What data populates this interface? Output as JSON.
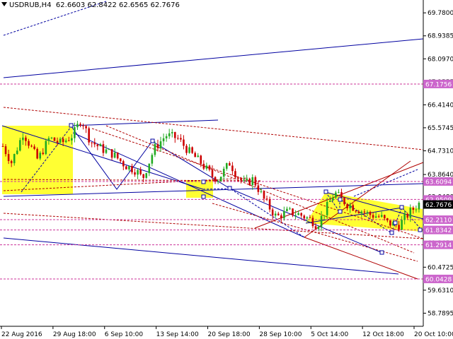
{
  "header": {
    "symbol": "USDRUB,H4",
    "ohlc": "62.6603 62.8422 62.6565 62.7676"
  },
  "colors": {
    "background": "#ffffff",
    "bull_candle": "#22aa22",
    "bear_candle": "#cc0000",
    "blue_lines": "#0000a0",
    "red_lines": "#b00000",
    "zones": "#ffff33",
    "label_bg": "#cc66cc",
    "current_bg": "#000000"
  },
  "chart_data": {
    "type": "candlestick",
    "title": "",
    "xlabel": "",
    "ylabel": "",
    "ylim": [
      58.31,
      70.25
    ],
    "y_ticks": [
      "69.7800",
      "68.9385",
      "68.0970",
      "67.2555",
      "66.4140",
      "65.5745",
      "64.7310",
      "63.8640",
      "63.0480",
      "62.2065",
      "61.3650",
      "60.4725",
      "59.6310",
      "58.7895"
    ],
    "x_ticks": [
      "22 Aug 2016",
      "29 Aug 18:00",
      "6 Sep 10:00",
      "13 Sep 14:00",
      "20 Sep 18:00",
      "28 Sep 10:00",
      "5 Oct 14:00",
      "12 Oct 18:00",
      "20 Oct 10:00"
    ],
    "price_labels": [
      {
        "text": "67.1756",
        "value": 67.1756,
        "kind": "level"
      },
      {
        "text": "63.6094",
        "value": 63.6094,
        "kind": "level"
      },
      {
        "text": "62.9509",
        "value": 62.9509,
        "kind": "level"
      },
      {
        "text": "62.7676",
        "value": 62.7676,
        "kind": "current"
      },
      {
        "text": "62.2110",
        "value": 62.211,
        "kind": "level"
      },
      {
        "text": "61.8342",
        "value": 61.8342,
        "kind": "level"
      },
      {
        "text": "61.2914",
        "value": 61.2914,
        "kind": "level"
      },
      {
        "text": "60.0428",
        "value": 60.0428,
        "kind": "level"
      }
    ],
    "candle_path": [
      [
        0,
        64.9
      ],
      [
        3,
        64.3
      ],
      [
        7,
        65.4
      ],
      [
        12,
        64.4
      ],
      [
        16,
        65.2
      ],
      [
        20,
        65.0
      ],
      [
        24,
        65.3
      ],
      [
        27,
        65.9
      ],
      [
        30,
        65.1
      ],
      [
        34,
        64.8
      ],
      [
        38,
        64.6
      ],
      [
        42,
        64.2
      ],
      [
        46,
        64.0
      ],
      [
        48,
        63.7
      ],
      [
        52,
        64.8
      ],
      [
        56,
        65.3
      ],
      [
        60,
        65.2
      ],
      [
        64,
        64.7
      ],
      [
        68,
        64.3
      ],
      [
        72,
        63.8
      ],
      [
        74,
        63.7
      ],
      [
        78,
        64.3
      ],
      [
        80,
        63.9
      ],
      [
        83,
        63.5
      ],
      [
        86,
        63.7
      ],
      [
        90,
        62.9
      ],
      [
        94,
        62.3
      ],
      [
        98,
        62.5
      ],
      [
        102,
        62.4
      ],
      [
        106,
        62.2
      ],
      [
        108,
        62.0
      ],
      [
        111,
        62.6
      ],
      [
        114,
        63.2
      ],
      [
        118,
        62.8
      ],
      [
        122,
        62.6
      ],
      [
        126,
        62.4
      ],
      [
        130,
        62.3
      ],
      [
        132,
        62.1
      ],
      [
        136,
        62.0
      ],
      [
        140,
        62.5
      ],
      [
        143,
        62.8
      ]
    ]
  }
}
